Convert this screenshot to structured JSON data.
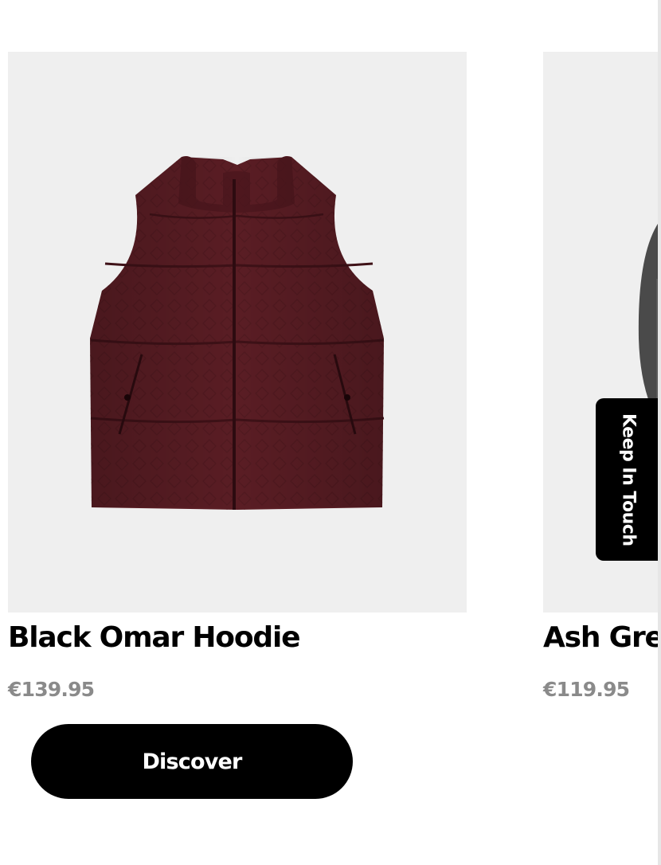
{
  "products": [
    {
      "name": "Black Omar Hoodie",
      "price": "€139.95",
      "image_icon": "puffer-vest-image",
      "image_bg": "#efefef",
      "garment_color": "#5a1d24"
    },
    {
      "name": "Ash Grey",
      "price": "€119.95",
      "image_icon": "garment-image",
      "image_bg": "#efefef",
      "garment_color": "#4a4a4a"
    }
  ],
  "discover_button": {
    "label": "Discover"
  },
  "keep_in_touch": {
    "label": "Keep In Touch"
  },
  "colors": {
    "price": "#8a8a8a",
    "button_bg": "#000000",
    "button_text": "#ffffff"
  }
}
